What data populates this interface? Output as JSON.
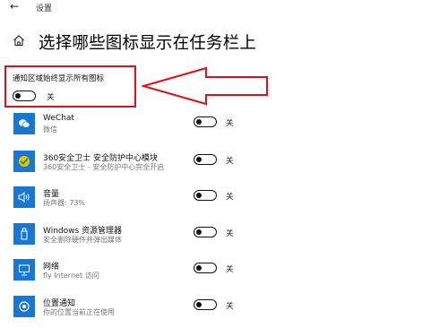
{
  "window": {
    "back_glyph": "←",
    "title": "设置"
  },
  "header": {
    "title": "选择哪些图标显示在任务栏上",
    "icon": "home-icon"
  },
  "always_show": {
    "label": "通知区域始终显示所有图标",
    "state": "关",
    "on": false,
    "highlight_color": "#e0101a"
  },
  "apps": [
    {
      "name": "WeChat",
      "subtitle": "微信",
      "state": "关",
      "on": false,
      "icon": "wechat-icon"
    },
    {
      "name": "360安全卫士 安全防护中心模块",
      "subtitle": "360安全卫士 - 安全防护中心完全开启",
      "state": "关",
      "on": false,
      "icon": "360-security-icon"
    },
    {
      "name": "音量",
      "subtitle": "扬声器: 73%",
      "state": "关",
      "on": false,
      "icon": "volume-icon"
    },
    {
      "name": "Windows 资源管理器",
      "subtitle": "安全删除硬件并弹出媒体",
      "state": "关",
      "on": false,
      "icon": "usb-eject-icon"
    },
    {
      "name": "网络",
      "subtitle": "fly Internet 访问",
      "state": "关",
      "on": false,
      "icon": "network-icon"
    },
    {
      "name": "位置通知",
      "subtitle": "你的位置当前正在使用",
      "state": "关",
      "on": false,
      "icon": "location-icon"
    }
  ],
  "colors": {
    "accent": "#1976d2",
    "annotation": "#e0101a"
  }
}
